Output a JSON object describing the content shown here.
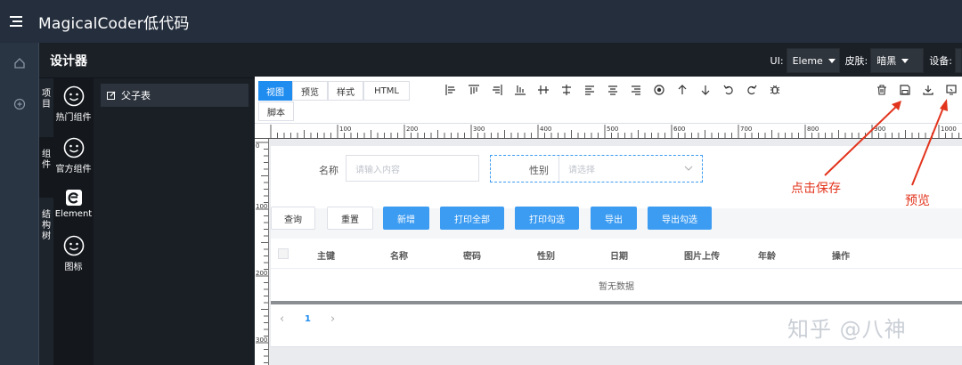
{
  "app": {
    "title": "MagicalCoder低代码"
  },
  "designer": {
    "title": "设计器",
    "ui_label": "UI:",
    "ui_value": "Eleme",
    "skin_label": "皮肤:",
    "skin_value": "暗黑",
    "device_label": "设备:"
  },
  "side_tabs": [
    "项目",
    "组件",
    "结构树"
  ],
  "components": [
    {
      "label": "热门组件",
      "icon": "smiley-icon"
    },
    {
      "label": "官方组件",
      "icon": "smiley-icon"
    },
    {
      "label": "Element",
      "icon": "element-logo-icon"
    },
    {
      "label": "图标",
      "icon": "smiley-icon"
    }
  ],
  "tree": {
    "item": "父子表"
  },
  "view_tabs": [
    "视图",
    "预览",
    "样式",
    "HTML",
    "脚本"
  ],
  "ruler_marks": [
    "100",
    "200",
    "300",
    "400",
    "500",
    "600",
    "700",
    "800",
    "900",
    "1000"
  ],
  "vruler_marks": [
    "0",
    "100",
    "200",
    "300"
  ],
  "form": {
    "name_label": "名称",
    "name_placeholder": "请输入内容",
    "gender_label": "性别",
    "gender_placeholder": "请选择"
  },
  "buttons": [
    "查询",
    "重置",
    "新增",
    "打印全部",
    "打印勾选",
    "导出",
    "导出勾选"
  ],
  "table": {
    "columns": [
      "主键",
      "名称",
      "密码",
      "性别",
      "日期",
      "图片上传",
      "年龄",
      "操作"
    ],
    "empty_text": "暂无数据"
  },
  "pager": {
    "prev": "‹",
    "page": "1",
    "next": "›"
  },
  "annotations": {
    "save": "点击保存",
    "preview": "预览"
  },
  "watermark": "知乎 @八神",
  "colors": {
    "accent": "#1f8cf0",
    "button_primary": "#3c9cf2",
    "annotation": "#e2341d"
  }
}
